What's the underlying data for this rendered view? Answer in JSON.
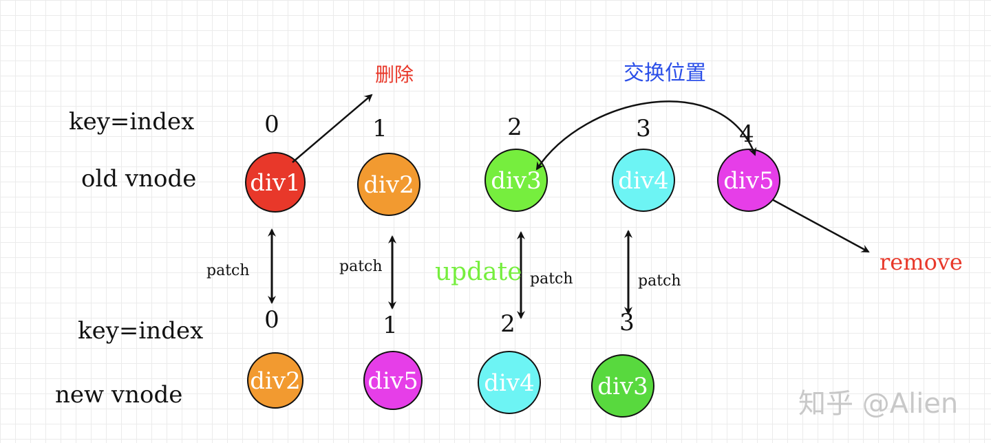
{
  "row_labels": {
    "old_key": "key=index",
    "old_vnode": "old vnode",
    "new_key": "key=index",
    "new_vnode": "new vnode"
  },
  "old_nodes": [
    {
      "index": "0",
      "label": "div1",
      "color": "#e8382a"
    },
    {
      "index": "1",
      "label": "div2",
      "color": "#f29a30"
    },
    {
      "index": "2",
      "label": "div3",
      "color": "#76ee3e"
    },
    {
      "index": "3",
      "label": "div4",
      "color": "#6df4f4"
    },
    {
      "index": "4",
      "label": "div5",
      "color": "#e63ee8"
    }
  ],
  "new_nodes": [
    {
      "index": "0",
      "label": "div2",
      "color": "#f29a30"
    },
    {
      "index": "1",
      "label": "div5",
      "color": "#e63ee8"
    },
    {
      "index": "2",
      "label": "div4",
      "color": "#6df4f4"
    },
    {
      "index": "3",
      "label": "div3",
      "color": "#58d93e"
    }
  ],
  "annotations": {
    "delete": {
      "text": "删除",
      "color": "#e8382a"
    },
    "swap": {
      "text": "交换位置",
      "color": "#2a4ee8"
    },
    "remove": {
      "text": "remove",
      "color": "#e8382a"
    },
    "update": {
      "text": "update",
      "color": "#76ee3e"
    }
  },
  "patch_labels": [
    "patch",
    "patch",
    "patch",
    "patch"
  ],
  "watermark": "知乎 @Alien"
}
